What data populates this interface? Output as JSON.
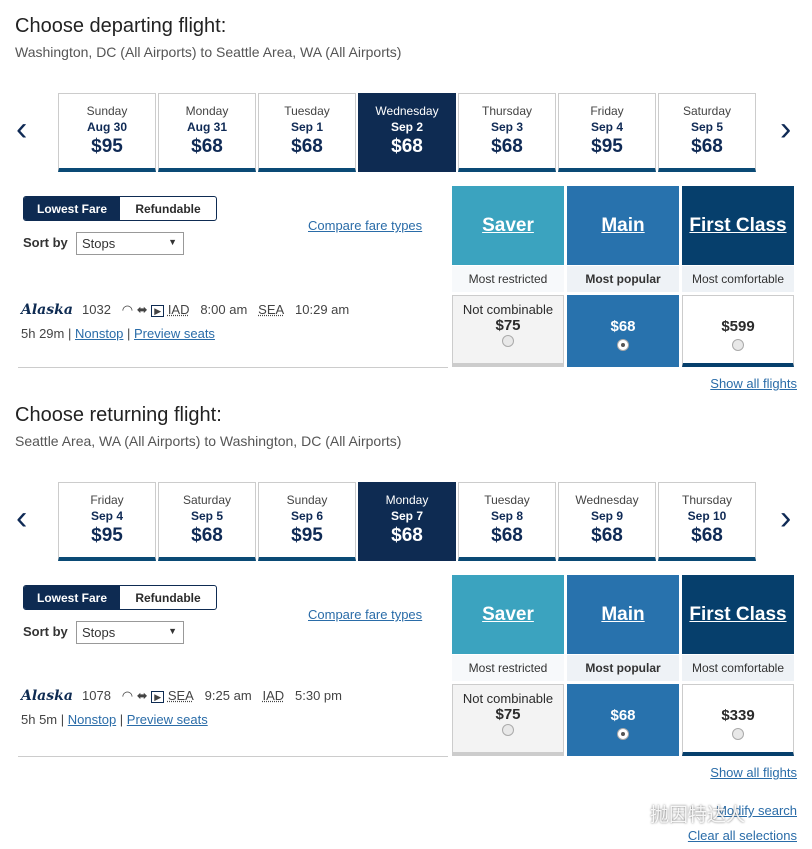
{
  "sections": [
    {
      "title": "Choose departing flight:",
      "subtitle": "Washington, DC (All Airports) to Seattle Area, WA (All Airports)",
      "dates": [
        {
          "day": "Sunday",
          "date": "Aug 30",
          "price": "$95"
        },
        {
          "day": "Monday",
          "date": "Aug 31",
          "price": "$68"
        },
        {
          "day": "Tuesday",
          "date": "Sep 1",
          "price": "$68"
        },
        {
          "day": "Wednesday",
          "date": "Sep 2",
          "price": "$68",
          "selected": true
        },
        {
          "day": "Thursday",
          "date": "Sep 3",
          "price": "$68"
        },
        {
          "day": "Friday",
          "date": "Sep 4",
          "price": "$95"
        },
        {
          "day": "Saturday",
          "date": "Sep 5",
          "price": "$68"
        }
      ],
      "flight": {
        "airline": "Alaska",
        "number": "1032",
        "from": "IAD",
        "depart": "8:00 am",
        "to": "SEA",
        "arrive": "10:29 am",
        "duration": "5h 29m",
        "stops": "Nonstop",
        "preview": "Preview seats"
      },
      "fares": {
        "saver": "$75",
        "main": "$68",
        "first": "$599"
      }
    },
    {
      "title": "Choose returning flight:",
      "subtitle": "Seattle Area, WA (All Airports) to Washington, DC (All Airports)",
      "dates": [
        {
          "day": "Friday",
          "date": "Sep 4",
          "price": "$95"
        },
        {
          "day": "Saturday",
          "date": "Sep 5",
          "price": "$68"
        },
        {
          "day": "Sunday",
          "date": "Sep 6",
          "price": "$95"
        },
        {
          "day": "Monday",
          "date": "Sep 7",
          "price": "$68",
          "selected": true
        },
        {
          "day": "Tuesday",
          "date": "Sep 8",
          "price": "$68"
        },
        {
          "day": "Wednesday",
          "date": "Sep 9",
          "price": "$68"
        },
        {
          "day": "Thursday",
          "date": "Sep 10",
          "price": "$68"
        }
      ],
      "flight": {
        "airline": "Alaska",
        "number": "1078",
        "from": "SEA",
        "depart": "9:25 am",
        "to": "IAD",
        "arrive": "5:30 pm",
        "duration": "5h 5m",
        "stops": "Nonstop",
        "preview": "Preview seats"
      },
      "fares": {
        "saver": "$75",
        "main": "$68",
        "first": "$339"
      }
    }
  ],
  "common": {
    "lowest_fare": "Lowest Fare",
    "refundable": "Refundable",
    "sort_label": "Sort by",
    "sort_value": "Stops",
    "compare": "Compare fare types",
    "saver": "Saver",
    "main": "Main",
    "first": "First Class",
    "saver_sub": "Most restricted",
    "main_sub": "Most popular",
    "first_sub": "Most comfortable",
    "not_combinable": "Not combinable",
    "show_all": "Show all flights"
  },
  "footer": {
    "modify": "Modify search",
    "clear": "Clear all selections",
    "watermark": "抛因特达人"
  },
  "colors": {
    "saver": "#3ba3bf",
    "main": "#2872ad",
    "first": "#063f6c",
    "navy": "#0e2b52"
  }
}
